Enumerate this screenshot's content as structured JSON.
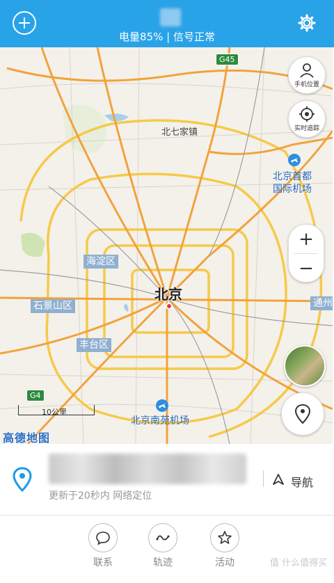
{
  "header": {
    "status": "电量85% | 信号正常",
    "add_icon": "plus-icon",
    "settings_icon": "gear-icon"
  },
  "map": {
    "city": "北京",
    "places": {
      "beiqijia": "北七家镇",
      "airport_capital_line1": "北京首都",
      "airport_capital_line2": "国际机场",
      "airport_nanyuan": "北京南苑机场",
      "haidian": "海淀区",
      "shijingshan": "石景山区",
      "fengtai": "丰台区",
      "tongzhou": "通州"
    },
    "highways": {
      "g45": "G45",
      "g4": "G4"
    },
    "buttons": {
      "phone_location": "手机位置",
      "realtime_tracking": "实时追踪",
      "zoom_in": "+",
      "zoom_out": "−"
    },
    "scale": "10公里",
    "logo": "高德地图"
  },
  "info": {
    "updated": "更新于20秒内  网络定位",
    "navigate": "导航"
  },
  "tabs": [
    {
      "label": "联系",
      "icon": "chat-icon"
    },
    {
      "label": "轨迹",
      "icon": "track-icon"
    },
    {
      "label": "活动",
      "icon": "star-icon"
    }
  ],
  "watermark": "值 什么值得买",
  "colors": {
    "header": "#29a3e8",
    "accent": "#1a9be6",
    "road": "#f6c94a"
  }
}
